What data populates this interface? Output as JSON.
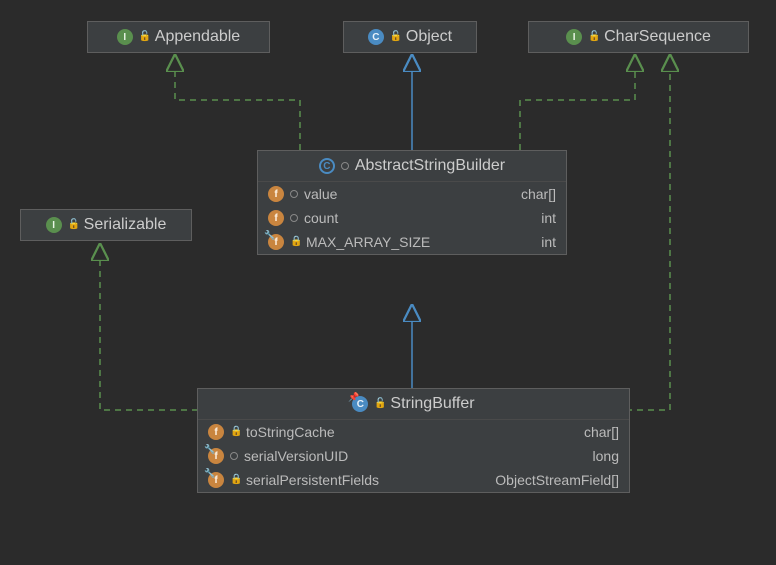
{
  "nodes": {
    "appendable": {
      "label": "Appendable",
      "type": "interface"
    },
    "object": {
      "label": "Object",
      "type": "class"
    },
    "charsequence": {
      "label": "CharSequence",
      "type": "interface"
    },
    "serializable": {
      "label": "Serializable",
      "type": "interface"
    },
    "abstractstringbuilder": {
      "label": "AbstractStringBuilder",
      "type": "abstract-class",
      "fields": [
        {
          "icon": "field",
          "vis": "package",
          "name": "value",
          "ftype": "char[]"
        },
        {
          "icon": "field",
          "vis": "package",
          "name": "count",
          "ftype": "int"
        },
        {
          "icon": "field-static",
          "vis": "private",
          "name": "MAX_ARRAY_SIZE",
          "ftype": "int"
        }
      ]
    },
    "stringbuffer": {
      "label": "StringBuffer",
      "type": "final-class",
      "fields": [
        {
          "icon": "field",
          "vis": "private",
          "name": "toStringCache",
          "ftype": "char[]"
        },
        {
          "icon": "field-static",
          "vis": "package",
          "name": "serialVersionUID",
          "ftype": "long"
        },
        {
          "icon": "field-static",
          "vis": "private",
          "name": "serialPersistentFields",
          "ftype": "ObjectStreamField[]"
        }
      ]
    }
  },
  "edges": [
    {
      "from": "abstractstringbuilder",
      "to": "appendable",
      "kind": "implements"
    },
    {
      "from": "abstractstringbuilder",
      "to": "object",
      "kind": "extends"
    },
    {
      "from": "abstractstringbuilder",
      "to": "charsequence",
      "kind": "implements"
    },
    {
      "from": "stringbuffer",
      "to": "abstractstringbuilder",
      "kind": "extends"
    },
    {
      "from": "stringbuffer",
      "to": "serializable",
      "kind": "implements"
    },
    {
      "from": "stringbuffer",
      "to": "charsequence",
      "kind": "implements"
    }
  ]
}
